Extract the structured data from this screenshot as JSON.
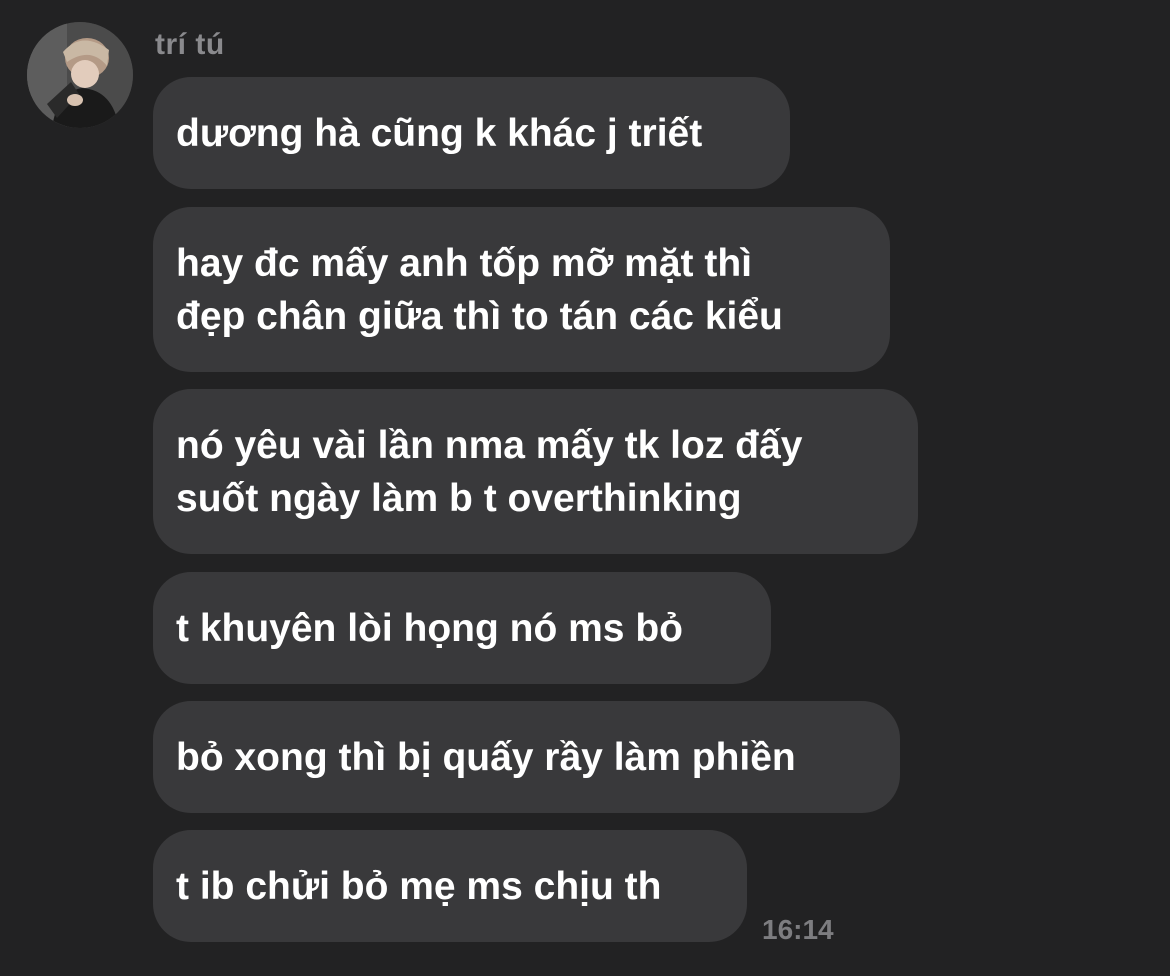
{
  "conversation": {
    "sender_name": "trí tú",
    "avatar_icon": "profile-photo-avatar",
    "messages": [
      {
        "lines": [
          "dương hà cũng k khác j triết"
        ]
      },
      {
        "lines": [
          "hay đc mấy anh tốp mỡ mặt thì",
          "đẹp chân giữa thì to tán các kiểu"
        ]
      },
      {
        "lines": [
          "nó yêu vài lần nma mấy tk loz đấy",
          "suốt ngày làm b t overthinking"
        ]
      },
      {
        "lines": [
          "t khuyên lòi họng nó ms bỏ"
        ]
      },
      {
        "lines": [
          "bỏ xong thì bị quấy rầy làm phiền"
        ]
      },
      {
        "lines": [
          "t ib chửi bỏ mẹ ms chịu th"
        ]
      }
    ],
    "timestamp": "16:14"
  },
  "colors": {
    "background": "#222223",
    "bubble": "#39393b",
    "message_text": "#ffffff",
    "sender_text": "#8a8a8d",
    "timestamp_text": "#7d7d80"
  }
}
